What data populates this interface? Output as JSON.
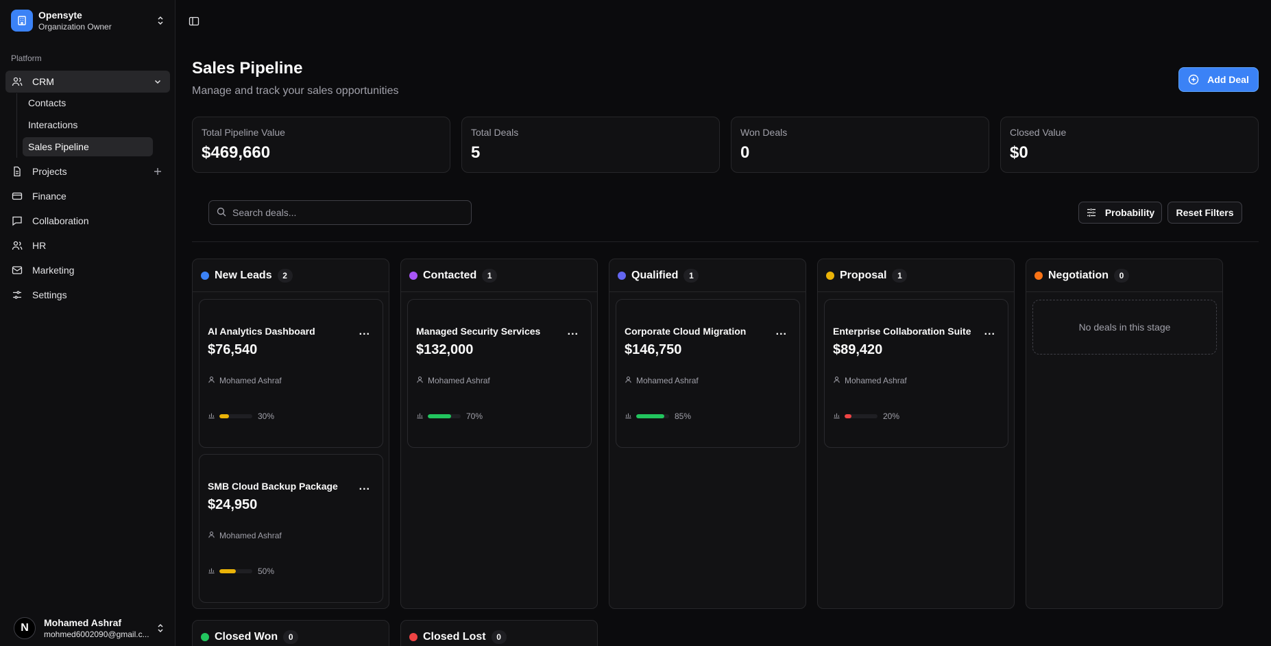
{
  "org": {
    "name": "Opensyte",
    "role": "Organization Owner"
  },
  "sidebar": {
    "group_label": "Platform",
    "items": [
      {
        "label": "CRM",
        "icon": "users-icon"
      },
      {
        "label": "Projects",
        "icon": "file-icon"
      },
      {
        "label": "Finance",
        "icon": "credit-card-icon"
      },
      {
        "label": "Collaboration",
        "icon": "message-icon"
      },
      {
        "label": "HR",
        "icon": "users-icon"
      },
      {
        "label": "Marketing",
        "icon": "mail-icon"
      },
      {
        "label": "Settings",
        "icon": "sliders-icon"
      }
    ],
    "crm_sub": [
      "Contacts",
      "Interactions",
      "Sales Pipeline"
    ]
  },
  "user": {
    "name": "Mohamed Ashraf",
    "email": "mohmed6002090@gmail.c...",
    "initial": "N"
  },
  "header": {
    "title": "Sales Pipeline",
    "subtitle": "Manage and track your sales opportunities",
    "add_label": "Add Deal"
  },
  "stats": [
    {
      "label": "Total Pipeline Value",
      "value": "$469,660"
    },
    {
      "label": "Total Deals",
      "value": "5"
    },
    {
      "label": "Won Deals",
      "value": "0"
    },
    {
      "label": "Closed Value",
      "value": "$0"
    }
  ],
  "filters": {
    "search_placeholder": "Search deals...",
    "probability_label": "Probability",
    "reset_label": "Reset Filters"
  },
  "columns": [
    {
      "title": "New Leads",
      "count": "2",
      "color": "#3b82f6"
    },
    {
      "title": "Contacted",
      "count": "1",
      "color": "#a855f7"
    },
    {
      "title": "Qualified",
      "count": "1",
      "color": "#6366f1"
    },
    {
      "title": "Proposal",
      "count": "1",
      "color": "#eab308"
    },
    {
      "title": "Negotiation",
      "count": "0",
      "color": "#f97316",
      "empty_text": "No deals in this stage"
    },
    {
      "title": "Closed Won",
      "count": "0",
      "color": "#22c55e"
    },
    {
      "title": "Closed Lost",
      "count": "0",
      "color": "#ef4444"
    }
  ],
  "deals": [
    {
      "title": "AI Analytics Dashboard",
      "amount": "$76,540",
      "owner": "Mohamed Ashraf",
      "probability": 30,
      "probability_label": "30%",
      "bar_color": "#eab308"
    },
    {
      "title": "SMB Cloud Backup Package",
      "amount": "$24,950",
      "owner": "Mohamed Ashraf",
      "probability": 50,
      "probability_label": "50%",
      "bar_color": "#eab308"
    },
    {
      "title": "Managed Security Services",
      "amount": "$132,000",
      "owner": "Mohamed Ashraf",
      "probability": 70,
      "probability_label": "70%",
      "bar_color": "#22c55e"
    },
    {
      "title": "Corporate Cloud Migration",
      "amount": "$146,750",
      "owner": "Mohamed Ashraf",
      "probability": 85,
      "probability_label": "85%",
      "bar_color": "#22c55e"
    },
    {
      "title": "Enterprise Collaboration Suite",
      "amount": "$89,420",
      "owner": "Mohamed Ashraf",
      "probability": 20,
      "probability_label": "20%",
      "bar_color": "#ef4444"
    }
  ],
  "deal_menu_label": "..."
}
